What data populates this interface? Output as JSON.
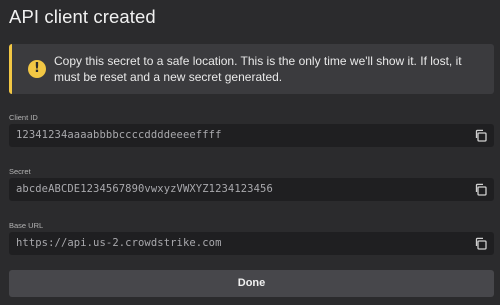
{
  "dialog": {
    "title": "API client created"
  },
  "alert": {
    "icon": "exclamation-icon",
    "message": "Copy this secret to a safe location. This is the only time we'll show it. If lost, it must be reset and a new secret generated.",
    "accent_color": "#f2c744"
  },
  "fields": {
    "client_id": {
      "label": "Client ID",
      "value": "12341234aaaabbbbccccddddeeeeffff"
    },
    "secret": {
      "label": "Secret",
      "value": "abcdeABCDE1234567890vwxyzVWXYZ1234123456"
    },
    "base_url": {
      "label": "Base URL",
      "value": "https://api.us-2.crowdstrike.com"
    }
  },
  "actions": {
    "copy_icon": "copy-icon",
    "done_label": "Done"
  }
}
